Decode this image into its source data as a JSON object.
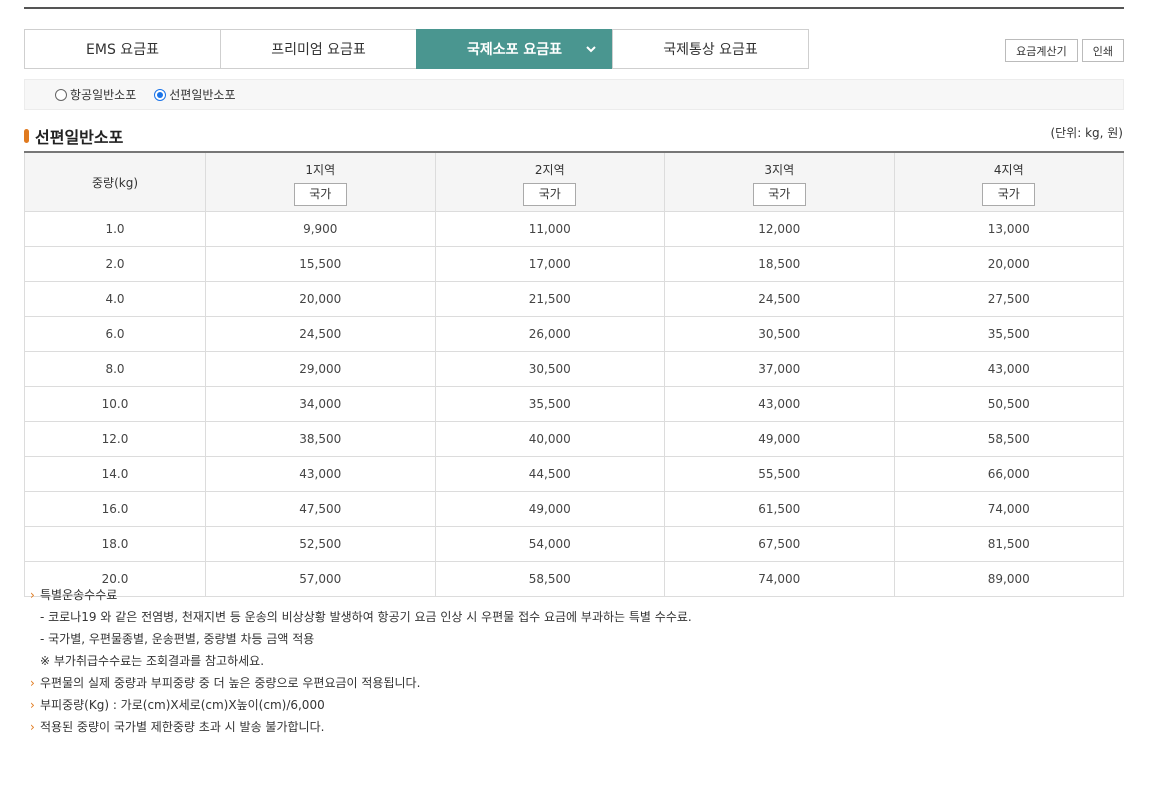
{
  "tabs": [
    {
      "label": "EMS 요금표",
      "active": false
    },
    {
      "label": "프리미엄 요금표",
      "active": false
    },
    {
      "label": "국제소포 요금표",
      "active": true
    },
    {
      "label": "국제통상 요금표",
      "active": false
    }
  ],
  "buttons": {
    "calculator": "요금계산기",
    "print": "인쇄"
  },
  "radios": [
    {
      "label": "항공일반소포",
      "checked": false
    },
    {
      "label": "선편일반소포",
      "checked": true
    }
  ],
  "section": {
    "title": "선편일반소포",
    "unit": "(단위: kg, 원)"
  },
  "table": {
    "weight_header": "중량(kg)",
    "regions": [
      "1지역",
      "2지역",
      "3지역",
      "4지역"
    ],
    "country_button": "국가",
    "rows": [
      [
        "1.0",
        "9,900",
        "11,000",
        "12,000",
        "13,000"
      ],
      [
        "2.0",
        "15,500",
        "17,000",
        "18,500",
        "20,000"
      ],
      [
        "4.0",
        "20,000",
        "21,500",
        "24,500",
        "27,500"
      ],
      [
        "6.0",
        "24,500",
        "26,000",
        "30,500",
        "35,500"
      ],
      [
        "8.0",
        "29,000",
        "30,500",
        "37,000",
        "43,000"
      ],
      [
        "10.0",
        "34,000",
        "35,500",
        "43,000",
        "50,500"
      ],
      [
        "12.0",
        "38,500",
        "40,000",
        "49,000",
        "58,500"
      ],
      [
        "14.0",
        "43,000",
        "44,500",
        "55,500",
        "66,000"
      ],
      [
        "16.0",
        "47,500",
        "49,000",
        "61,500",
        "74,000"
      ],
      [
        "18.0",
        "52,500",
        "54,000",
        "67,500",
        "81,500"
      ],
      [
        "20.0",
        "57,000",
        "58,500",
        "74,000",
        "89,000"
      ]
    ]
  },
  "notes": {
    "n1": "특별운송수수료",
    "n1a": "- 코로나19 와 같은 전염병, 천재지변 등 운송의 비상상황 발생하여 항공기 요금 인상 시 우편물 접수 요금에 부과하는 특별 수수료.",
    "n1b": "- 국가별, 우편물종별, 운송편별, 중량별 차등 금액 적용",
    "n1c": "※ 부가취급수수료는 조회결과를 참고하세요.",
    "n2": "우편물의 실제 중량과 부피중량 중 더 높은 중량으로 우편요금이 적용됩니다.",
    "n3": "부피중량(Kg) : 가로(cm)X세로(cm)X높이(cm)/6,000",
    "n4": "적용된 중량이 국가별 제한중량 초과 시 발송 불가합니다."
  },
  "colors": {
    "active_tab": "#4a9690",
    "accent": "#e07a1f",
    "radio": "#1a73e8"
  }
}
